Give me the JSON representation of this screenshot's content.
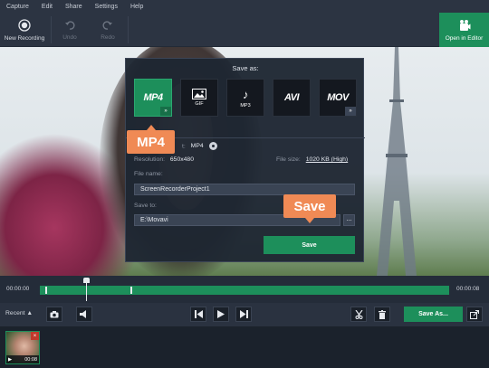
{
  "menu": [
    "Capture",
    "Edit",
    "Share",
    "Settings",
    "Help"
  ],
  "toolbar": {
    "new_recording": "New Recording",
    "undo": "Undo",
    "redo": "Redo",
    "open_in_editor": "Open in Editor"
  },
  "dialog": {
    "title": "Save as:",
    "formats": [
      {
        "big": "MP4",
        "sub": "",
        "selected": true,
        "has_more": true,
        "icon": "mp4-icon"
      },
      {
        "big": "",
        "sub": "GIF",
        "selected": false,
        "has_more": false,
        "icon": "gif-image-icon"
      },
      {
        "big": "♪",
        "sub": "MP3",
        "selected": false,
        "has_more": false,
        "icon": "music-note-icon"
      },
      {
        "big": "AVI",
        "sub": "",
        "selected": false,
        "has_more": false,
        "icon": "avi-icon"
      },
      {
        "big": "MOV",
        "sub": "",
        "selected": false,
        "has_more": true,
        "icon": "mov-icon"
      }
    ],
    "more_glyph": "»",
    "format_label_tail": "t:",
    "format_value": "MP4",
    "resolution_label": "Resolution:",
    "resolution_value": "650x480",
    "filesize_label": "File size:",
    "filesize_value": "1020 KB (High)",
    "filename_label": "File name:",
    "filename_value": "ScreenRecorderProject1",
    "saveto_label": "Save to:",
    "saveto_value": "E:\\Movavi",
    "browse_label": "...",
    "save_button": "Save"
  },
  "callouts": {
    "mp4": "MP4",
    "save": "Save"
  },
  "timeline": {
    "start": "00:00:00",
    "end": "00:00:08"
  },
  "controls": {
    "recent": "Recent ▲",
    "save_as": "Save As..."
  },
  "recent_item": {
    "duration": "00:08",
    "close": "×"
  },
  "colors": {
    "accent": "#1d8f5b",
    "callout": "#f08a55",
    "background": "#1d2532"
  }
}
